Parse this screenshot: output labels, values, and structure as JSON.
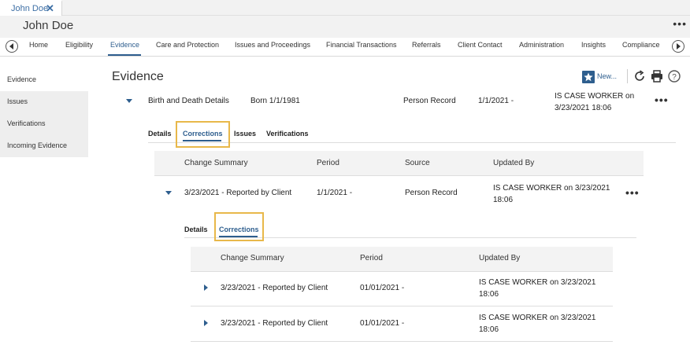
{
  "tab": {
    "label": "John Doe",
    "close": "✕"
  },
  "header": {
    "person_name": "John Doe",
    "more": "•••"
  },
  "nav": {
    "items": [
      "Home",
      "Eligibility",
      "Evidence",
      "Care and Protection",
      "Issues and Proceedings",
      "Financial Transactions",
      "Referrals",
      "Client Contact",
      "Administration",
      "Insights",
      "Compliance"
    ],
    "active": "Evidence"
  },
  "sidebar": {
    "items": [
      "Evidence",
      "Issues",
      "Verifications",
      "Incoming Evidence"
    ],
    "active": "Evidence"
  },
  "main": {
    "title": "Evidence",
    "new_label": "New...",
    "evidence_row": {
      "type": "Birth and Death Details",
      "born": "Born 1/1/1981",
      "source": "Person Record",
      "period": "1/1/2021 -",
      "updated_by": "IS CASE WORKER on 3/23/2021 18:06",
      "more": "•••"
    },
    "detail_tabs": [
      "Details",
      "Corrections",
      "Issues",
      "Verifications"
    ],
    "corrections_table": {
      "headers": [
        "Change Summary",
        "Period",
        "Source",
        "Updated By"
      ],
      "row": {
        "summary": "3/23/2021 - Reported by Client",
        "period": "1/1/2021 -",
        "source": "Person Record",
        "updated_by": "IS CASE WORKER on 3/23/2021 18:06",
        "more": "•••"
      }
    },
    "nested_tabs": [
      "Details",
      "Corrections"
    ],
    "nested_table": {
      "headers": [
        "Change Summary",
        "Period",
        "Updated By"
      ],
      "rows": [
        {
          "summary": "3/23/2021 - Reported by Client",
          "period": "01/01/2021 -",
          "updated_by": "IS CASE WORKER on 3/23/2021 18:06"
        },
        {
          "summary": "3/23/2021 - Reported by Client",
          "period": "01/01/2021 -",
          "updated_by": "IS CASE WORKER on 3/23/2021 18:06"
        }
      ]
    }
  },
  "colors": {
    "accent": "#2e5e8e",
    "highlight": "#e8b84a",
    "sidebar_bg": "#eeeeee"
  }
}
